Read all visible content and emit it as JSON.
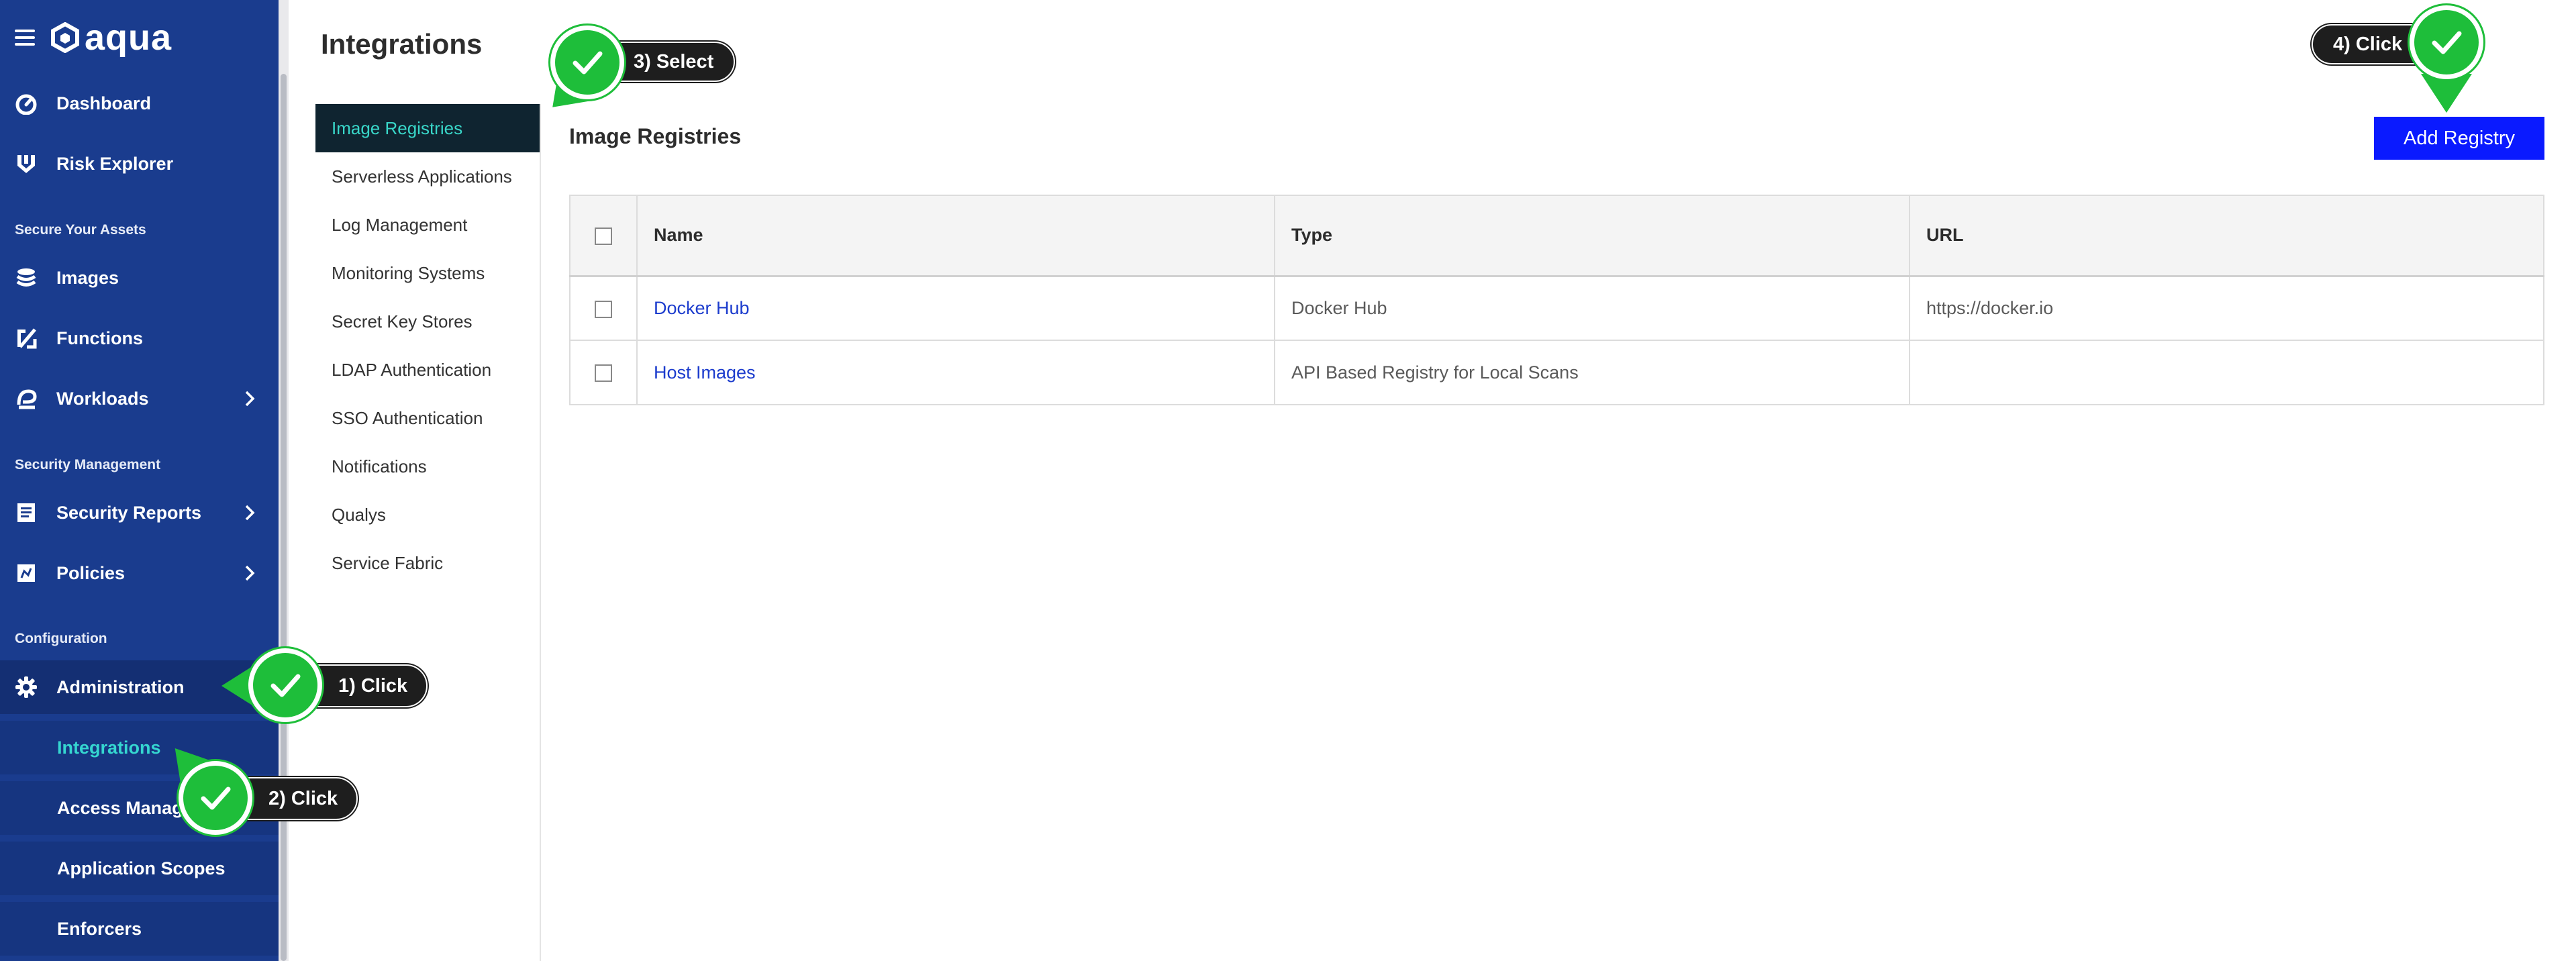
{
  "app": {
    "brand": "aqua"
  },
  "sidebar": {
    "items": [
      {
        "label": "Dashboard",
        "icon": "gauge-icon"
      },
      {
        "label": "Risk Explorer",
        "icon": "risk-explorer-icon"
      }
    ],
    "section_assets": "Secure Your Assets",
    "asset_items": [
      {
        "label": "Images",
        "icon": "layers-icon"
      },
      {
        "label": "Functions",
        "icon": "functions-icon"
      },
      {
        "label": "Workloads",
        "icon": "workloads-icon"
      }
    ],
    "section_security": "Security Management",
    "security_items": [
      {
        "label": "Security Reports",
        "icon": "report-icon"
      },
      {
        "label": "Policies",
        "icon": "policies-icon"
      }
    ],
    "section_config": "Configuration",
    "admin_label": "Administration",
    "admin_subitems": [
      {
        "label": "Integrations"
      },
      {
        "label": "Access Manag"
      },
      {
        "label": "Application Scopes"
      },
      {
        "label": "Enforcers"
      }
    ]
  },
  "page": {
    "title": "Integrations"
  },
  "subnav": {
    "items": [
      {
        "label": "Image Registries"
      },
      {
        "label": "Serverless Applications"
      },
      {
        "label": "Log Management"
      },
      {
        "label": "Monitoring Systems"
      },
      {
        "label": "Secret Key Stores"
      },
      {
        "label": "LDAP Authentication"
      },
      {
        "label": "SSO Authentication"
      },
      {
        "label": "Notifications"
      },
      {
        "label": "Qualys"
      },
      {
        "label": "Service Fabric"
      }
    ]
  },
  "main": {
    "section_title": "Image Registries",
    "add_button": "Add Registry",
    "table": {
      "headers": [
        "Name",
        "Type",
        "URL"
      ],
      "rows": [
        {
          "name": "Docker Hub",
          "type": "Docker Hub",
          "url": "https://docker.io"
        },
        {
          "name": "Host Images",
          "type": "API Based Registry for Local Scans",
          "url": ""
        }
      ]
    }
  },
  "tutorial": {
    "step1": "1) Click",
    "step2": "2) Click",
    "step3": "3) Select",
    "step4": "4) Click",
    "accent_color": "#1ebe3a"
  },
  "colors": {
    "sidebar_bg": "#1a3c8e",
    "active_text": "#35d6d0",
    "primary_button": "#0a1aff",
    "link": "#1c3ccd"
  }
}
